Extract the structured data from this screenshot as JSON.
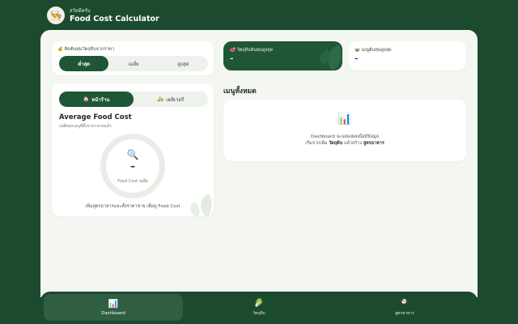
{
  "app": {
    "subtitle": "สวัสดีครับ",
    "title": "Food Cost Calculator",
    "logo_icon": "chef-icon"
  },
  "cost_basis": {
    "label": "💰 คิดต้นทุนวัตถุดิบจากราคา",
    "options": [
      "ต่ำสุด",
      "เฉลี่ย",
      "สูงสุด"
    ],
    "selected": "ต่ำสุด"
  },
  "channel_tabs": {
    "storefront": {
      "icon": "🏠",
      "label": "หน้าร้าน"
    },
    "delivery": {
      "icon": "🛵",
      "label": "เดลิเวอรี"
    },
    "selected": "หน้าร้าน"
  },
  "average": {
    "title": "Average Food Cost",
    "subtitle": "เฉลี่ยทุกเมนูที่ตั้งราคาขายแล้ว",
    "icon": "🔍",
    "value": "–",
    "value_label": "Food Cost เฉลี่ย",
    "hint": "เพิ่มสูตรอาหารและตั้งราคาขาย เพื่อดู Food Cost"
  },
  "stats": {
    "highest_ingredient": {
      "label": "🥩 วัตถุดิบต้นทุนสูงสุด",
      "value": "–"
    },
    "highest_menu": {
      "label": "🍲 เมนูต้นทุนสูงสุด",
      "value": "–"
    }
  },
  "menus": {
    "heading": "เมนูทั้งหมด",
    "empty_icon": "📊",
    "empty_line1": "Dashboard จะแสดงผลเมื่อมีข้อมูล",
    "empty_line2_prefix": "เริ่มจากเพิ่ม ",
    "empty_line2_ingredient": "วัตถุดิบ",
    "empty_line2_mid": " แล้วสร้าง ",
    "empty_line2_recipe": "สูตรอาหาร"
  },
  "nav": [
    {
      "icon": "📊",
      "label": "Dashboard",
      "active": true
    },
    {
      "icon": "🥬",
      "label": "วัตถุดิบ",
      "active": false
    },
    {
      "icon": "🍳",
      "label": "สูตรอาหาร",
      "active": false
    }
  ],
  "colors": {
    "brand_dark": "#1c4a2f",
    "accent": "#1e5636",
    "background": "#f4f6f2"
  }
}
